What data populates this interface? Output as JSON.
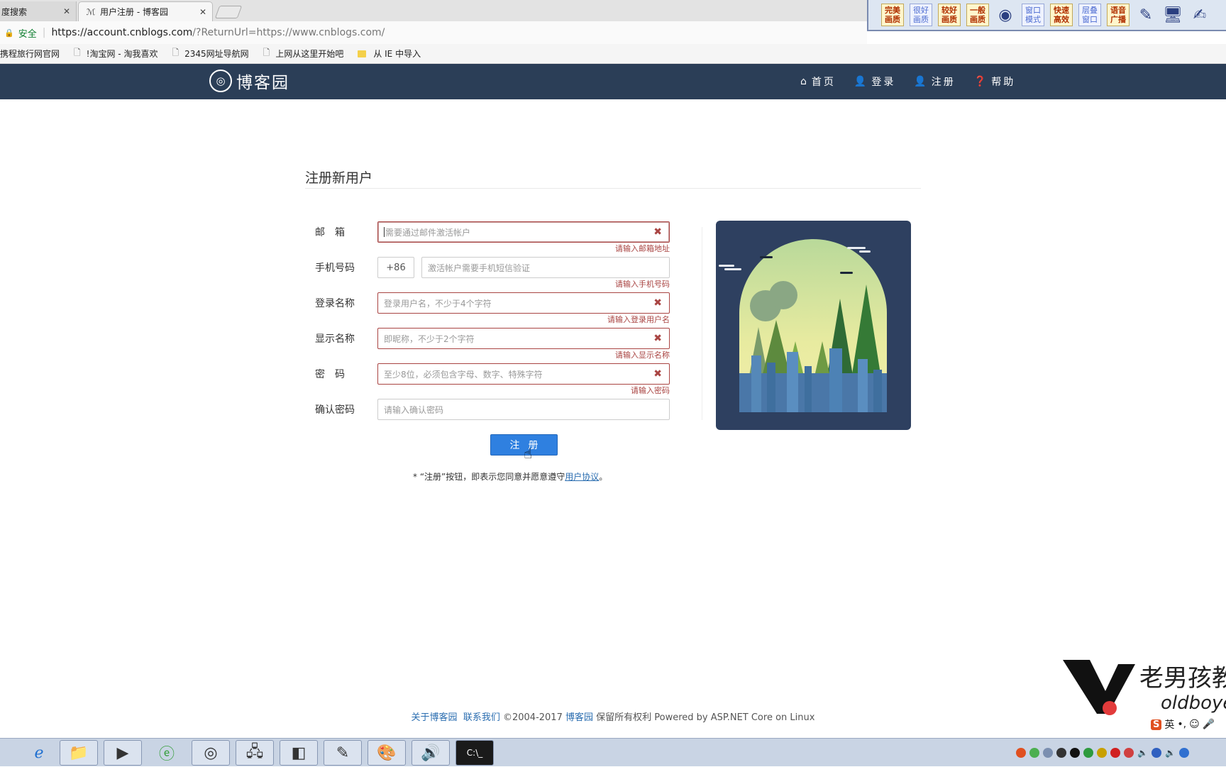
{
  "browser": {
    "tabs": [
      {
        "label": "度搜索",
        "active": false
      },
      {
        "label": "用户注册 - 博客园",
        "active": true
      }
    ],
    "address": {
      "secure_label": "安全",
      "url_host": "https://account.cnblogs.com",
      "url_rest": "/?ReturnUrl=https://www.cnblogs.com/"
    },
    "bookmarks": [
      {
        "label": "携程旅行网官网",
        "icon": "none"
      },
      {
        "label": "!淘宝网 - 淘我喜欢",
        "icon": "page-icon"
      },
      {
        "label": "2345网址导航网",
        "icon": "page-icon"
      },
      {
        "label": "上网从这里开始吧",
        "icon": "page-icon"
      },
      {
        "label": "从 IE 中导入",
        "icon": "folder-icon"
      }
    ],
    "extension_buttons": [
      "完美画质",
      "很好画质",
      "较好画质",
      "一般画质",
      "窗口模式",
      "快速高效",
      "层叠窗口",
      "语音广播"
    ]
  },
  "navbar": {
    "logo_text": "博客园",
    "links": [
      {
        "label": "首页",
        "icon": "home-icon"
      },
      {
        "label": "登录",
        "icon": "user-icon"
      },
      {
        "label": "注册",
        "icon": "user-icon"
      },
      {
        "label": "帮助",
        "icon": "question-icon"
      }
    ]
  },
  "form": {
    "heading": "注册新用户",
    "email": {
      "label": "邮　箱",
      "placeholder": "需要通过邮件激活帐户",
      "error": "请输入邮箱地址"
    },
    "phone": {
      "label": "手机号码",
      "prefix": "+86",
      "placeholder": "激活帐户需要手机短信验证",
      "error": "请输入手机号码"
    },
    "login_name": {
      "label": "登录名称",
      "placeholder": "登录用户名，不少于4个字符",
      "error": "请输入登录用户名"
    },
    "display_name": {
      "label": "显示名称",
      "placeholder": "即昵称，不少于2个字符",
      "error": "请输入显示名称"
    },
    "password": {
      "label": "密　码",
      "placeholder": "至少8位，必须包含字母、数字、特殊字符",
      "error": "请输入密码"
    },
    "confirm_password": {
      "label": "确认密码",
      "placeholder": "请输入确认密码"
    },
    "submit_label": "注册",
    "agreement_prefix": "* “注册”按钮，即表示您同意并愿意遵守",
    "agreement_link": "用户协议",
    "agreement_suffix": "。"
  },
  "footer": {
    "about": "关于博客园",
    "contact": "联系我们",
    "copyright": "©2004-2017",
    "site": "博客园",
    "rest": "保留所有权利 Powered by ASP.NET Core on Linux"
  },
  "watermark": {
    "text": "老男孩教",
    "sub": "oldboyedu"
  },
  "taskbar": {
    "apps": [
      "ie-icon",
      "folder-icon",
      "media-player-icon",
      "360-browser-icon",
      "chrome-icon",
      "remote-desktop-icon",
      "powerpoint-icon",
      "notepad-icon",
      "paint-icon",
      "volume-app-icon",
      "terminal-icon"
    ],
    "ime_label": "英"
  },
  "colors": {
    "navbar_bg": "#2b3e57",
    "error": "#a94442",
    "primary_button": "#2f80e0",
    "link": "#2a6db0"
  }
}
